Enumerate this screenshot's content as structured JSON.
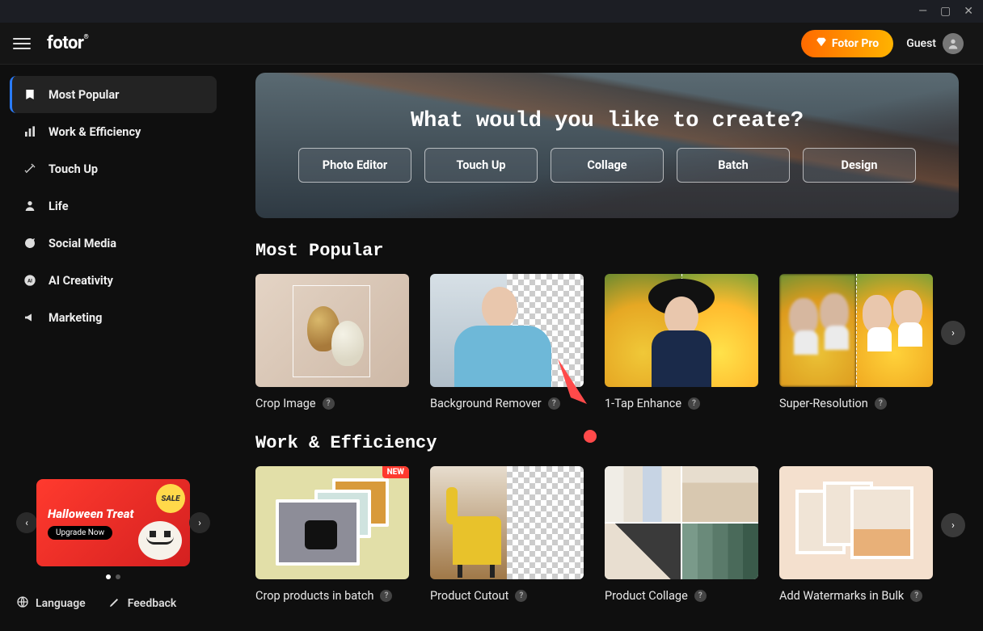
{
  "titlebar": {
    "minimize": "—",
    "maximize": "▢",
    "close": "✕"
  },
  "topbar": {
    "logo": "fotor",
    "pro_label": "Fotor Pro",
    "guest_label": "Guest"
  },
  "sidebar": {
    "items": [
      {
        "id": "most-popular",
        "label": "Most Popular",
        "active": true
      },
      {
        "id": "work-efficiency",
        "label": "Work & Efficiency",
        "active": false
      },
      {
        "id": "touch-up",
        "label": "Touch Up",
        "active": false
      },
      {
        "id": "life",
        "label": "Life",
        "active": false
      },
      {
        "id": "social-media",
        "label": "Social Media",
        "active": false
      },
      {
        "id": "ai-creativity",
        "label": "AI Creativity",
        "active": false
      },
      {
        "id": "marketing",
        "label": "Marketing",
        "active": false
      }
    ],
    "promo": {
      "badge": "SALE",
      "title": "Halloween Treat",
      "cta": "Upgrade Now"
    },
    "footer": {
      "language": "Language",
      "feedback": "Feedback"
    }
  },
  "hero": {
    "title": "What would you like to create?",
    "buttons": [
      "Photo Editor",
      "Touch Up",
      "Collage",
      "Batch",
      "Design"
    ]
  },
  "sections": {
    "most_popular": {
      "title": "Most Popular",
      "cards": [
        {
          "label": "Crop Image"
        },
        {
          "label": "Background Remover"
        },
        {
          "label": "1-Tap Enhance"
        },
        {
          "label": "Super-Resolution"
        }
      ]
    },
    "work_efficiency": {
      "title": "Work & Efficiency",
      "cards": [
        {
          "label": "Crop products in batch",
          "badge": "NEW"
        },
        {
          "label": "Product Cutout"
        },
        {
          "label": "Product Collage"
        },
        {
          "label": "Add Watermarks in Bulk"
        }
      ]
    }
  }
}
